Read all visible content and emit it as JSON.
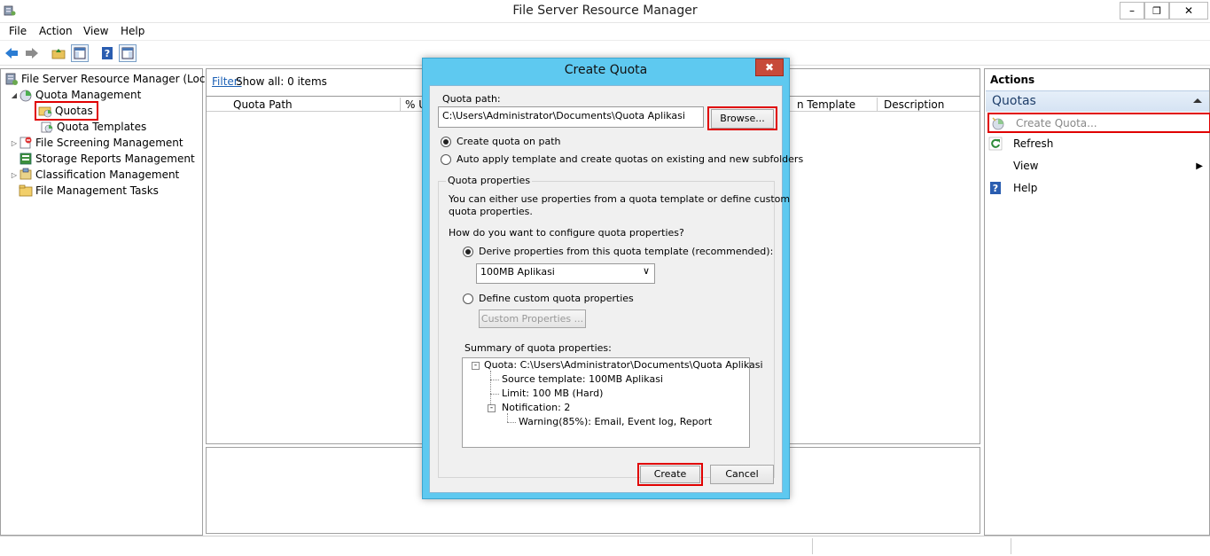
{
  "window": {
    "title": "File Server Resource Manager",
    "minimize_glyph": "–",
    "maximize_glyph": "❐",
    "close_glyph": "✕"
  },
  "menu": [
    "File",
    "Action",
    "View",
    "Help"
  ],
  "tree": {
    "root": "File Server Resource Manager (Local)",
    "quota_management": "Quota Management",
    "quotas": "Quotas",
    "quota_templates": "Quota Templates",
    "file_screening": "File Screening Management",
    "storage_reports": "Storage Reports Management",
    "classification": "Classification Management",
    "file_mgmt_tasks": "File Management Tasks"
  },
  "center": {
    "filter_link": "Filter:",
    "filter_text": "Show all: 0 items",
    "columns": [
      "Quota Path",
      "% U",
      "n Template",
      "Description"
    ]
  },
  "actions": {
    "title": "Actions",
    "section": "Quotas",
    "items": [
      "Create Quota...",
      "Refresh",
      "View",
      "Help"
    ]
  },
  "dialog": {
    "title": "Create Quota",
    "close": "✖",
    "quota_path_label": "Quota path:",
    "quota_path_value": "C:\\Users\\Administrator\\Documents\\Quota Aplikasi",
    "browse_button": "Browse...",
    "radio_create_on_path": "Create quota on path",
    "radio_auto_apply": "Auto apply template and create quotas on existing and new subfolders",
    "properties_group": "Quota properties",
    "properties_desc_1": "You can either use properties from a quota template or define custom",
    "properties_desc_2": "quota properties.",
    "how_configure": "How do you want to configure quota properties?",
    "radio_derive": "Derive properties from this quota template (recommended):",
    "template_selected": "100MB Aplikasi",
    "radio_custom": "Define custom quota properties",
    "custom_props_button": "Custom Properties ...",
    "summary_label": "Summary of quota properties:",
    "summary": {
      "quota": "Quota: C:\\Users\\Administrator\\Documents\\Quota Aplikasi",
      "source_template": "Source template: 100MB Aplikasi",
      "limit": "Limit: 100 MB (Hard)",
      "notification": "Notification: 2",
      "warning": "Warning(85%): Email, Event log, Report"
    },
    "create_button": "Create",
    "cancel_button": "Cancel"
  },
  "colors": {
    "highlight": "#e00000",
    "dialog_frame": "#5ec9f0",
    "link": "#1a5fb4"
  }
}
